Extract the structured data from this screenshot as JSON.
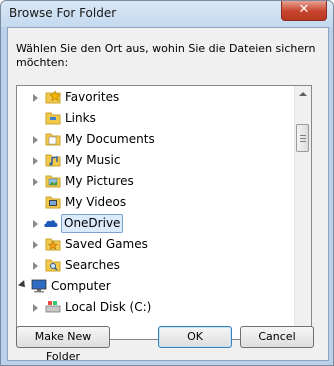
{
  "window": {
    "title": "Browse For Folder",
    "close_glyph": "✕"
  },
  "description": "Wählen Sie den Ort aus, wohin Sie die Dateien sichern\nmöchten:",
  "tree": {
    "items": [
      {
        "label": "Favorites",
        "icon": "favorites-star-folder-icon"
      },
      {
        "label": "Links",
        "icon": "links-folder-icon"
      },
      {
        "label": "My Documents",
        "icon": "documents-folder-icon"
      },
      {
        "label": "My Music",
        "icon": "music-folder-icon"
      },
      {
        "label": "My Pictures",
        "icon": "pictures-folder-icon"
      },
      {
        "label": "My Videos",
        "icon": "videos-folder-icon"
      },
      {
        "label": "OneDrive",
        "icon": "onedrive-cloud-icon",
        "selected": true
      },
      {
        "label": "Saved Games",
        "icon": "saved-games-folder-icon"
      },
      {
        "label": "Searches",
        "icon": "searches-folder-icon"
      },
      {
        "label": "Computer",
        "icon": "computer-icon"
      },
      {
        "label": "Local Disk (C:)",
        "icon": "local-disk-icon"
      }
    ]
  },
  "buttons": {
    "make_new_folder": "Make New Folder",
    "ok": "OK",
    "cancel": "Cancel"
  },
  "colors": {
    "selection_fill": "#dcebfc",
    "selection_border": "#7da2ce",
    "folder_yellow": "#f2c94c",
    "onedrive_blue": "#1e5bb8"
  }
}
